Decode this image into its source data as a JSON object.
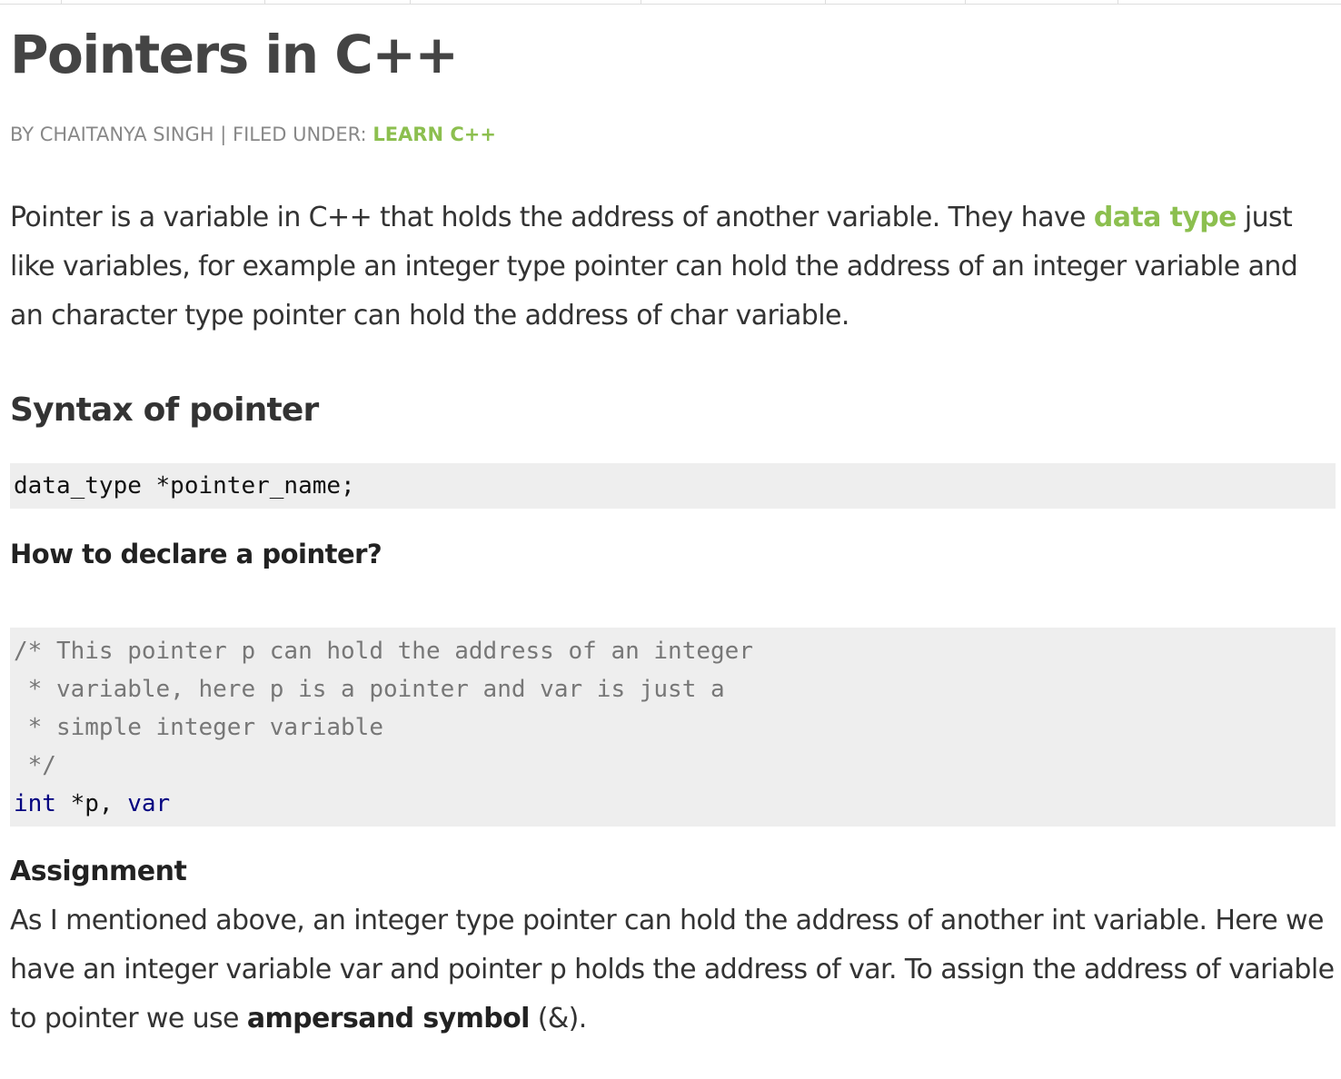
{
  "article": {
    "title": "Pointers in C++",
    "byline_prefix": "BY CHAITANYA SINGH | FILED UNDER: ",
    "category": "LEARN C++"
  },
  "intro": {
    "before_link": "Pointer is a variable in C++ that holds the address of another variable. They have ",
    "link": "data type",
    "after_link": " just like variables, for example an integer type pointer can hold the address of an integer variable and an character type pointer can hold the address of char variable."
  },
  "syntax": {
    "heading": "Syntax of pointer",
    "code": "data_type *pointer_name;"
  },
  "declare": {
    "heading": "How to declare a pointer?",
    "comment_lines": [
      "/* This pointer p can hold the address of an integer",
      " * variable, here p is a pointer and var is just a",
      " * simple integer variable",
      " */"
    ],
    "code_keyword": "int",
    "code_middle": " *p, ",
    "code_var": "var"
  },
  "assignment": {
    "heading": "Assignment",
    "text_before": "As I mentioned above, an integer type pointer can hold the address of another int variable. Here we have an integer variable var and pointer p holds the address of var. To assign the address of variable to pointer we use ",
    "bold": "ampersand symbol",
    "text_after": " (&)."
  }
}
